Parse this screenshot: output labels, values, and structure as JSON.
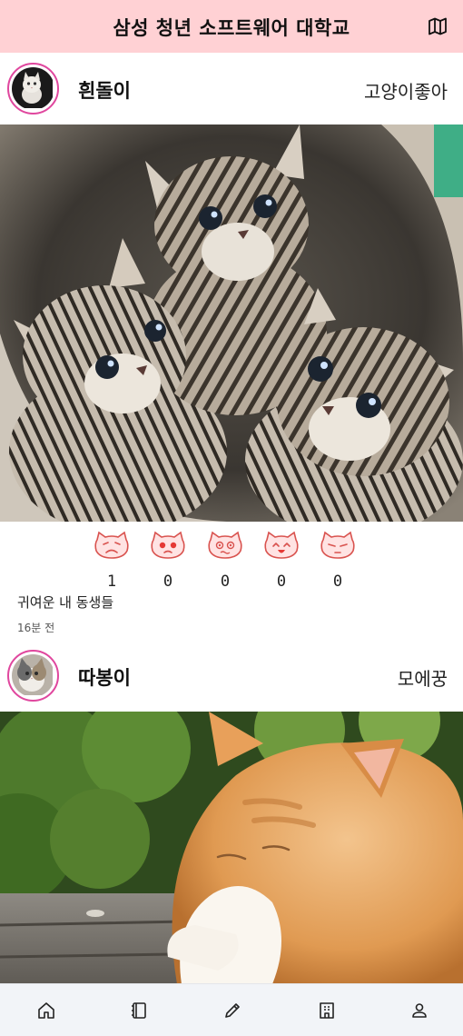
{
  "header": {
    "title": "삼성 청년 소프트웨어 대학교",
    "map_icon": "map-icon"
  },
  "posts": [
    {
      "username": "흰돌이",
      "tag": "고양이좋아",
      "photo": "three tabby kittens",
      "reactions": [
        {
          "icon": "sad-cat-face-icon",
          "count": "1"
        },
        {
          "icon": "angry-cat-face-icon",
          "count": "0"
        },
        {
          "icon": "dizzy-cat-face-icon",
          "count": "0"
        },
        {
          "icon": "happy-cat-face-icon",
          "count": "0"
        },
        {
          "icon": "sleepy-cat-face-icon",
          "count": "0"
        }
      ],
      "caption": "귀여운 내 동생들",
      "time": "16분 전"
    },
    {
      "username": "따봉이",
      "tag": "모에꿍",
      "photo": "orange and white cat sleeping in sunlight"
    }
  ],
  "bottom_nav": [
    {
      "icon": "home-icon"
    },
    {
      "icon": "book-icon"
    },
    {
      "icon": "pencil-icon"
    },
    {
      "icon": "building-icon"
    },
    {
      "icon": "user-icon"
    }
  ],
  "colors": {
    "header_bg": "#ffd1d4",
    "avatar_ring": "#e0479e",
    "reaction_face": "#ffe3e3",
    "reaction_outline": "#d9534f",
    "bottom_bar_bg": "#f2f4f8"
  }
}
